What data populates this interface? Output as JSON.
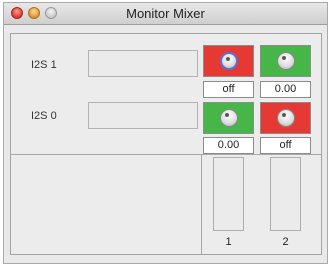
{
  "window": {
    "title": "Monitor Mixer"
  },
  "inputs": [
    {
      "label": "I2S 1"
    },
    {
      "label": "I2S 0"
    }
  ],
  "matrix": [
    [
      {
        "color": "#e53a33",
        "value": "off",
        "active": true
      },
      {
        "color": "#46b649",
        "value": "0.00",
        "active": false
      }
    ],
    [
      {
        "color": "#46b649",
        "value": "0.00",
        "active": false
      },
      {
        "color": "#e53a33",
        "value": "off",
        "active": false
      }
    ]
  ],
  "outputs": [
    {
      "label": "1"
    },
    {
      "label": "2"
    }
  ],
  "icons": {
    "close": "close-dot-icon",
    "minimize": "minimize-dot-icon",
    "zoom": "zoom-dot-icon",
    "knob": "knob-icon"
  }
}
